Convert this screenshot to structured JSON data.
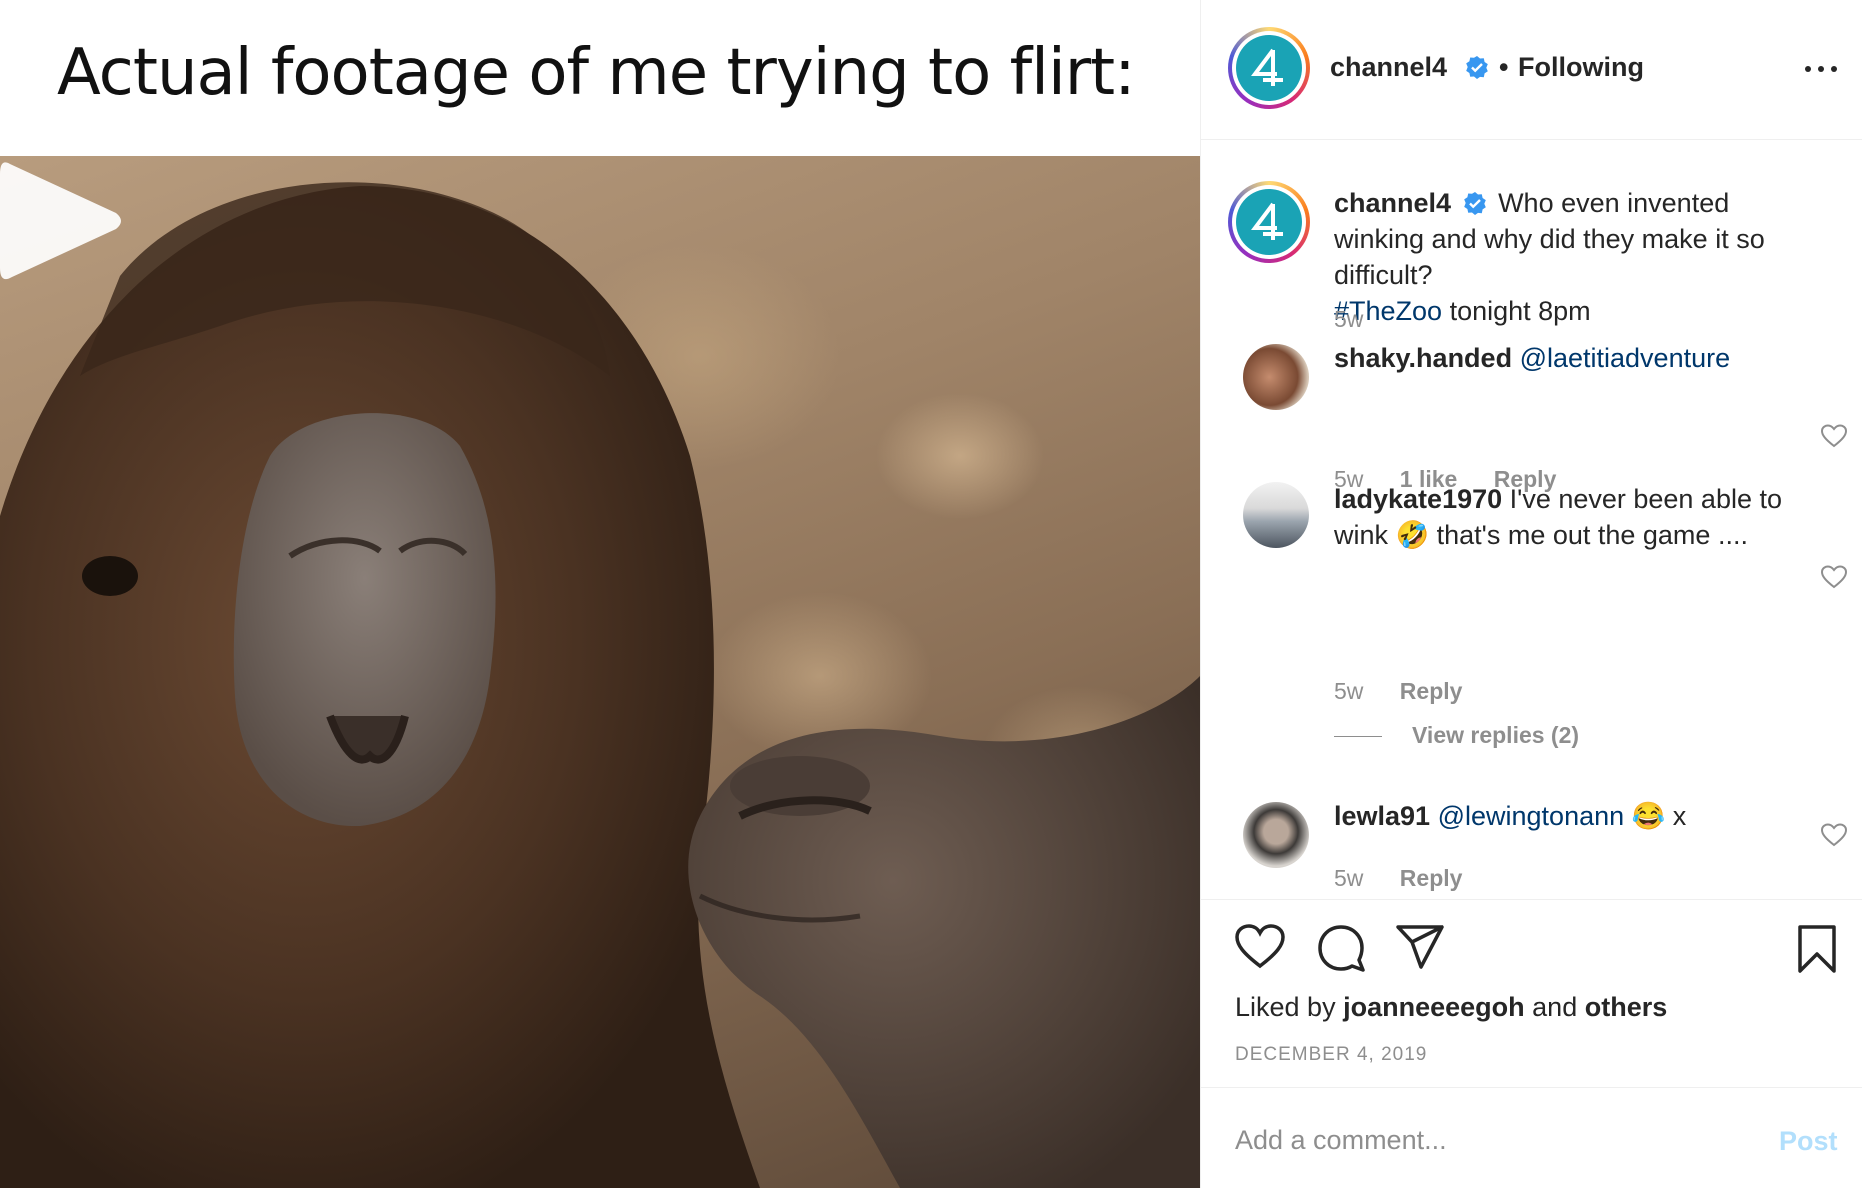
{
  "media": {
    "caption": "Actual footage of me trying to flirt:",
    "play_icon": "play-icon"
  },
  "header": {
    "username": "channel4",
    "verified_icon": "verified-badge-icon",
    "separator": "•",
    "follow_status": "Following",
    "more_icon": "more-options-icon"
  },
  "post_caption": {
    "username": "channel4",
    "text": "Who even invented winking and why did they make it so difficult?",
    "hashtag": "#TheZoo",
    "text_after": " tonight 8pm",
    "time": "5w"
  },
  "comments": [
    {
      "username": "shaky.handed",
      "mention": "@laetitiadventure",
      "text": "",
      "time": "5w",
      "likes": "1 like",
      "reply": "Reply"
    },
    {
      "username": "ladykate1970",
      "mention": "",
      "text": "I've never been able to wink 🤣  that's me out the game ....",
      "time": "5w",
      "likes": "",
      "reply": "Reply",
      "view_replies": "View replies (2)"
    },
    {
      "username": "lewla91",
      "mention": "@lewingtonann",
      "text": "😂  x",
      "time": "5w",
      "likes": "",
      "reply": "Reply"
    }
  ],
  "actions": {
    "like_icon": "heart-icon",
    "comment_icon": "comment-icon",
    "share_icon": "share-icon",
    "save_icon": "bookmark-icon",
    "liked_prefix": "Liked by",
    "liked_user": "joanneeeegoh",
    "liked_and": "and",
    "liked_others": "others",
    "date": "DECEMBER 4, 2019"
  },
  "add_comment": {
    "placeholder": "Add a comment...",
    "post_label": "Post"
  },
  "colors": {
    "accent": "#0095f6",
    "mention": "#00376b",
    "muted": "#8e8e8e",
    "post_disabled": "#b2dffc",
    "channel4_teal": "#1aa3b5"
  }
}
